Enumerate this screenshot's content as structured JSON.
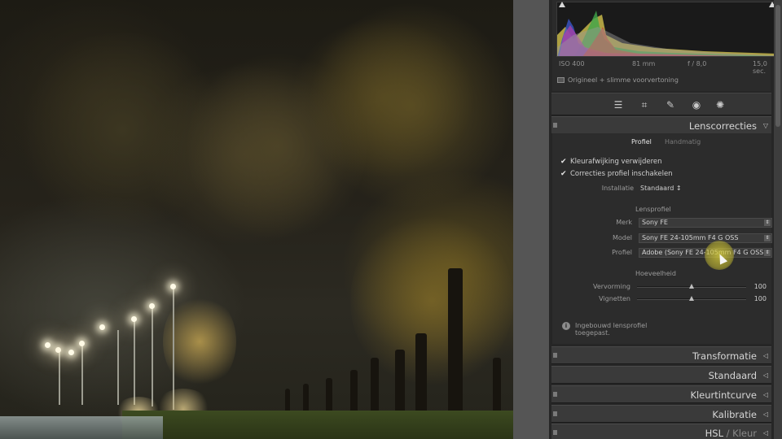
{
  "histogram": {
    "iso": "ISO 400",
    "focal_length": "81 mm",
    "aperture": "f / 8,0",
    "shutter": "15,0 sec.",
    "preview_label": "Origineel + slimme voorvertoning"
  },
  "toolstrip": {
    "icons": [
      "sliders-icon",
      "crop-icon",
      "heal-icon",
      "redeye-icon",
      "mask-icon"
    ]
  },
  "lens_corrections": {
    "title": "Lenscorrecties",
    "tabs": [
      "Profiel",
      "Handmatig"
    ],
    "remove_ca_label": "Kleurafwijking verwijderen",
    "enable_profile_label": "Correcties profiel inschakelen",
    "setup_label": "Installatie",
    "setup_value": "Standaard ↕",
    "lens_profile_title": "Lensprofiel",
    "make_label": "Merk",
    "make_value": "Sony FE",
    "model_label": "Model",
    "model_value": "Sony FE 24-105mm F4 G OSS",
    "profile_label": "Profiel",
    "profile_value": "Adobe (Sony FE 24-105mm F4 G OSS)",
    "amount_title": "Hoeveelheid",
    "distortion_label": "Vervorming",
    "distortion_value": "100",
    "distortion_level": 0.5,
    "vignetting_label": "Vignetten",
    "vignetting_value": "100",
    "vignetting_level": 0.5,
    "info_line1": "Ingebouwd lensprofiel",
    "info_line2": "toegepast."
  },
  "sections": {
    "transform": "Transformatie",
    "basic": "Standaard",
    "tone_curve": "Kleurtintcurve",
    "calibration": "Kalibratie",
    "hsl_a": "HSL",
    "hsl_sep": " / ",
    "hsl_b": "Kleur"
  }
}
